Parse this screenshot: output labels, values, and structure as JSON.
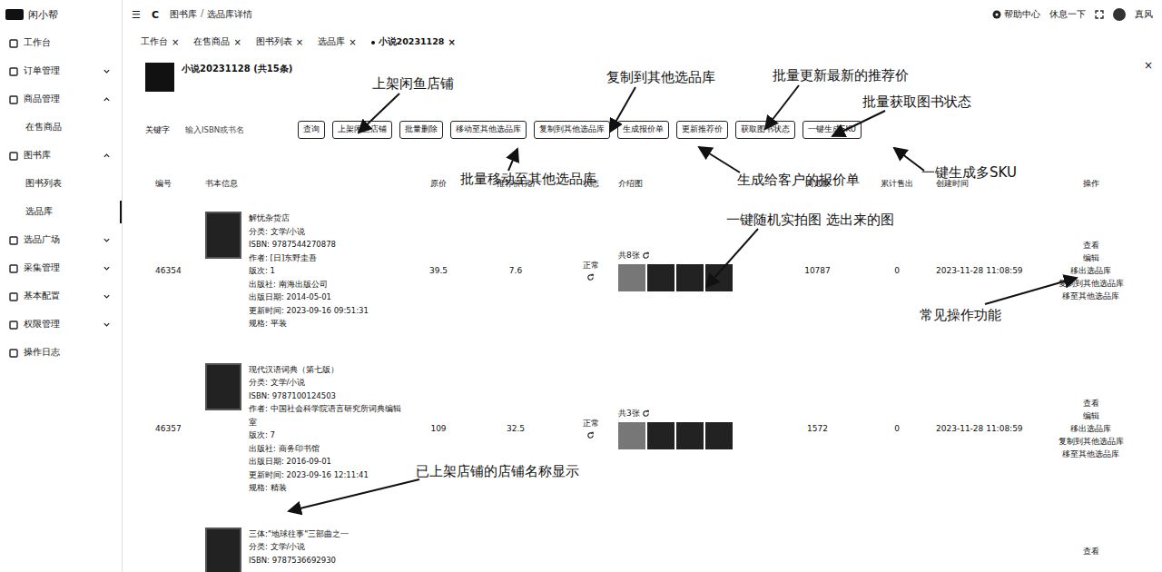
{
  "app": {
    "logo": "闲小帮"
  },
  "topbar": {
    "menu_icon": "☰",
    "refresh_icon": "C",
    "breadcrumb": [
      "图书库",
      "选品库详情"
    ],
    "separator": "/",
    "help": "帮助中心",
    "rest": "休息一下",
    "user": "真风"
  },
  "sidebar": {
    "items": [
      {
        "label": "工作台",
        "kind": "item",
        "expanded": false,
        "selected": false
      },
      {
        "label": "订单管理",
        "kind": "group",
        "expanded": false,
        "selected": false
      },
      {
        "label": "商品管理",
        "kind": "group",
        "expanded": true,
        "selected": false
      },
      {
        "label": "在售商品",
        "kind": "child",
        "expanded": false,
        "selected": false
      },
      {
        "label": "图书库",
        "kind": "group",
        "expanded": true,
        "selected": false
      },
      {
        "label": "图书列表",
        "kind": "child",
        "expanded": false,
        "selected": false
      },
      {
        "label": "选品库",
        "kind": "child",
        "expanded": false,
        "selected": true
      },
      {
        "label": "选品广场",
        "kind": "group",
        "expanded": false,
        "selected": false
      },
      {
        "label": "采集管理",
        "kind": "group",
        "expanded": false,
        "selected": false
      },
      {
        "label": "基本配置",
        "kind": "group",
        "expanded": false,
        "selected": false
      },
      {
        "label": "权限管理",
        "kind": "group",
        "expanded": false,
        "selected": false
      },
      {
        "label": "操作日志",
        "kind": "item",
        "expanded": false,
        "selected": false
      }
    ]
  },
  "tabs": {
    "close": "×",
    "items": [
      {
        "label": "工作台",
        "selected": false
      },
      {
        "label": "在售商品",
        "selected": false
      },
      {
        "label": "图书列表",
        "selected": false
      },
      {
        "label": "选品库",
        "selected": false
      },
      {
        "label": "小说20231128",
        "selected": true
      }
    ]
  },
  "panel": {
    "title": "小说20231128 (共15条)",
    "close": "×"
  },
  "filter": {
    "label": "关键字",
    "placeholder": "输入ISBN或书名"
  },
  "buttons": [
    "查询",
    "上架闲鱼店铺",
    "批量删除",
    "移动至其他选品库",
    "复制到其他选品库",
    "生成报价单",
    "更新推荐价",
    "获取图书状态",
    "一键生成SKU"
  ],
  "table": {
    "columns": [
      "编号",
      "书本信息",
      "原价",
      "推荐价(元)",
      "状态",
      "介绍图",
      "浏览数",
      "累计售出",
      "创建时间",
      "操作"
    ],
    "rows": [
      {
        "id": "46354",
        "title": "解忧杂货店",
        "info": [
          "分类: 文学/小说",
          "ISBN: 9787544270878",
          "作者: [日]东野圭吾",
          "版次: 1",
          "出版社: 南海出版公司",
          "出版日期: 2014-05-01",
          "更新时间: 2023-09-16 09:51:31",
          "规格: 平装"
        ],
        "price": "39.5",
        "suggested": "7.6",
        "status": "正常",
        "images_count": "共8张",
        "thumbs": 4,
        "views": "10787",
        "sold": "0",
        "created": "2023-11-28 11:08:59",
        "actions": [
          "查看",
          "编辑",
          "移出选品库",
          "复制到其他选品库",
          "移至其他选品库"
        ]
      },
      {
        "id": "46357",
        "title": "现代汉语词典（第七版）",
        "info": [
          "分类: 文学/小说",
          "ISBN: 9787100124503",
          "作者: 中国社会科学院语言研究所词典编辑室",
          "版次: 7",
          "出版社: 商务印书馆",
          "出版日期: 2016-09-01",
          "更新时间: 2023-09-16 12:11:41",
          "规格: 精装"
        ],
        "price": "109",
        "suggested": "32.5",
        "status": "正常",
        "images_count": "共3张",
        "thumbs": 4,
        "views": "1572",
        "sold": "0",
        "created": "2023-11-28 11:08:59",
        "actions": [
          "查看",
          "编辑",
          "移出选品库",
          "复制到其他选品库",
          "移至其他选品库"
        ]
      },
      {
        "id": "",
        "title": "三体:\"地球往事\"三部曲之一",
        "info": [
          "分类: 文学/小说",
          "ISBN: 9787536692930"
        ],
        "price": "",
        "suggested": "",
        "status": "",
        "images_count": "",
        "thumbs": 0,
        "views": "",
        "sold": "",
        "created": "",
        "actions": [
          "查看"
        ]
      }
    ]
  },
  "annotations": [
    "上架闲鱼店铺",
    "复制到其他选品库",
    "批量更新最新的推荐价",
    "批量获取图书状态",
    "批量移动至其他选品库",
    "生成给客户的报价单",
    "一键生成多SKU",
    "一键随机实拍图 选出来的图",
    "常见操作功能",
    "已上架店铺的店铺名称显示"
  ]
}
